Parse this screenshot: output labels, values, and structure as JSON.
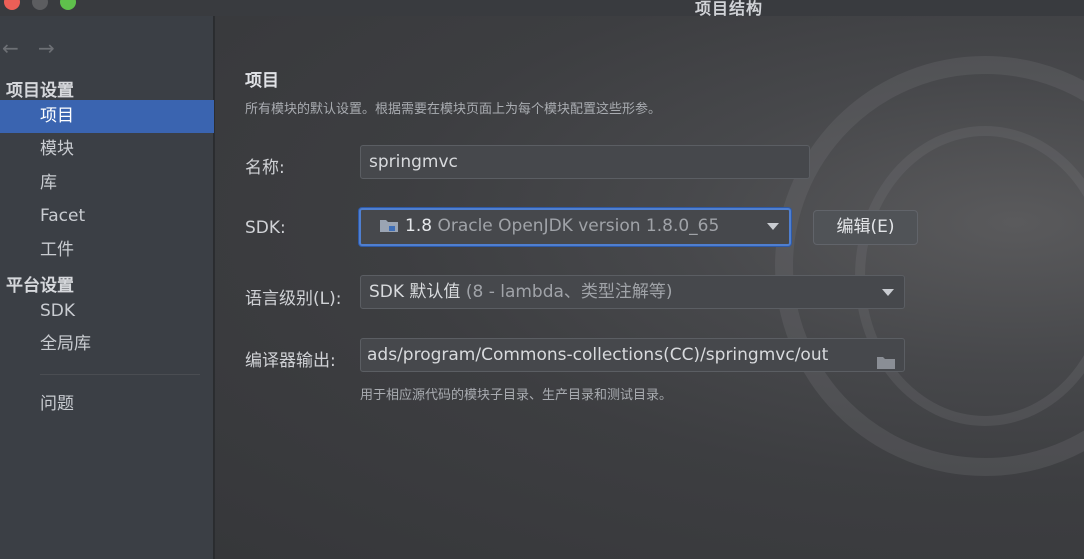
{
  "window": {
    "title": "项目结构",
    "colors": {
      "close": "#ec5f57",
      "minimize": "#5c5d60",
      "zoom": "#5fc04c",
      "accent": "#3a64b0"
    }
  },
  "nav": {
    "back_icon": "arrow-left-icon",
    "forward_icon": "arrow-right-icon",
    "back": "←",
    "forward": "→"
  },
  "sidebar": {
    "project_settings_header": "项目设置",
    "project_settings_items": [
      {
        "label": "项目",
        "selected": true
      },
      {
        "label": "模块"
      },
      {
        "label": "库"
      },
      {
        "label": "Facet"
      },
      {
        "label": "工件"
      }
    ],
    "platform_settings_header": "平台设置",
    "platform_settings_items": [
      {
        "label": "SDK"
      },
      {
        "label": "全局库"
      }
    ],
    "problems_item": "问题"
  },
  "main": {
    "title": "项目",
    "subtitle": "所有模块的默认设置。根据需要在模块页面上为每个模块配置这些形参。",
    "name_label": "名称:",
    "name_value": "springmvc",
    "sdk_label": "SDK:",
    "sdk_version": "1.8",
    "sdk_detail": "Oracle OpenJDK version 1.8.0_65",
    "sdk_icon": "folder-icon",
    "edit_button": "编辑(E)",
    "language_level_label": "语言级别(L):",
    "language_level_value": "SDK 默认值",
    "language_level_detail": "(8 - lambda、类型注解等)",
    "compiler_output_label": "编译器输出:",
    "compiler_output_value": "ads/program/Commons-collections(CC)/springmvc/out",
    "compiler_output_hint": "用于相应源代码的模块子目录、生产目录和测试目录。"
  }
}
